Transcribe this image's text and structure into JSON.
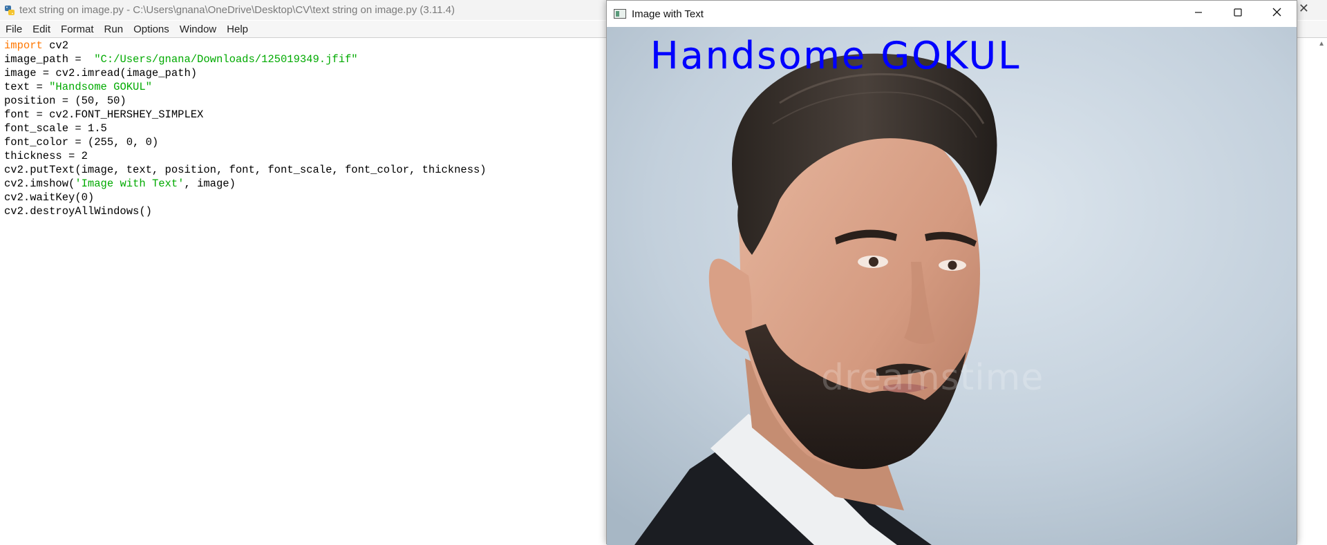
{
  "idle": {
    "title": "text string on image.py - C:\\Users\\gnana\\OneDrive\\Desktop\\CV\\text string on image.py (3.11.4)",
    "menu": [
      "File",
      "Edit",
      "Format",
      "Run",
      "Options",
      "Window",
      "Help"
    ],
    "code": {
      "l1_kw": "import",
      "l1_rest": " cv2",
      "l2_pre": "image_path =  ",
      "l2_str": "\"C:/Users/gnana/Downloads/125019349.jfif\"",
      "l3": "image = cv2.imread(image_path)",
      "l4_pre": "text = ",
      "l4_str": "\"Handsome GOKUL\"",
      "l5": "position = (50, 50)",
      "l6": "font = cv2.FONT_HERSHEY_SIMPLEX",
      "l7": "font_scale = 1.5",
      "l8": "font_color = (255, 0, 0)",
      "l9": "thickness = 2",
      "l10": "cv2.putText(image, text, position, font, font_scale, font_color, thickness)",
      "l11_pre": "cv2.imshow(",
      "l11_str": "'Image with Text'",
      "l11_post": ", image)",
      "l12": "cv2.waitKey(0)",
      "l13": "cv2.destroyAllWindows()"
    },
    "close_glyph": "✕",
    "scroll_up_glyph": "▲"
  },
  "cv_window": {
    "title": "Image with Text",
    "overlay_text": "Handsome GOKUL",
    "watermark": "dreamstime"
  },
  "colors": {
    "keyword": "#ff7700",
    "string": "#00aa00",
    "overlay_text": "#0000ff",
    "background_image": "#c3d0dc"
  }
}
